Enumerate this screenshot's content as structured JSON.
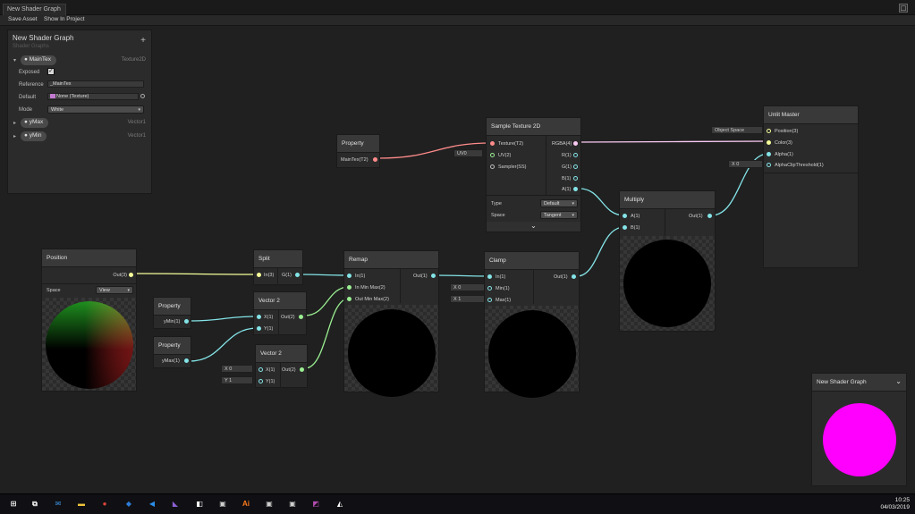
{
  "window": {
    "tab_title": "New Shader Graph"
  },
  "toolbar": {
    "save_asset": "Save Asset",
    "show_in_project": "Show In Project"
  },
  "blackboard": {
    "title": "New Shader Graph",
    "subtitle": "Shader Graphs",
    "add": "+",
    "main_tex": {
      "name": "MainTex",
      "type": "Texture2D",
      "exposed_label": "Exposed",
      "exposed_checked": "✓",
      "reference_label": "Reference",
      "reference_value": "_MainTex",
      "default_label": "Default",
      "default_value": "None (Texture)",
      "mode_label": "Mode",
      "mode_value": "White"
    },
    "ymax": {
      "name": "yMax",
      "type": "Vector1"
    },
    "ymin": {
      "name": "yMin",
      "type": "Vector1"
    }
  },
  "nodes": {
    "position": {
      "title": "Position",
      "out": "Out(3)",
      "space_label": "Space",
      "space_value": "View"
    },
    "split": {
      "title": "Split",
      "in": "In(3)",
      "out_g": "G(1)"
    },
    "property_ymin": {
      "title": "Property",
      "out": "yMin(1)"
    },
    "property_ymax": {
      "title": "Property",
      "out": "yMax(1)"
    },
    "vector2_a": {
      "title": "Vector 2",
      "x": "X(1)",
      "y": "Y(1)",
      "out": "Out(2)"
    },
    "vector2_b": {
      "title": "Vector 2",
      "x": "X(1)",
      "y": "Y(1)",
      "out": "Out(2)",
      "x_field": "X 0",
      "y_field": "Y 1"
    },
    "remap": {
      "title": "Remap",
      "in": "In(1)",
      "in_minmax": "In Min Max(2)",
      "out_minmax": "Out Min Max(2)",
      "out": "Out(1)"
    },
    "clamp": {
      "title": "Clamp",
      "in": "In(1)",
      "min": "Min(1)",
      "max": "Max(1)",
      "out": "Out(1)",
      "min_field": "X 0",
      "max_field": "X 1"
    },
    "property_maintex": {
      "title": "Property",
      "out": "MainTex(T2)"
    },
    "sample_texture": {
      "title": "Sample Texture 2D",
      "texture": "Texture(T2)",
      "uv": "UV(2)",
      "sampler": "Sampler(SS)",
      "rgba": "RGBA(4)",
      "r": "R(1)",
      "g": "G(1)",
      "b": "B(1)",
      "a": "A(1)",
      "uv_field": "UV0",
      "type_label": "Type",
      "type_value": "Default",
      "space_label": "Space",
      "space_value": "Tangent",
      "expand": "⌄"
    },
    "multiply": {
      "title": "Multiply",
      "a": "A(1)",
      "b": "B(1)",
      "out": "Out(1)"
    },
    "unlit_master": {
      "title": "Unlit Master",
      "position": "Position(3)",
      "color": "Color(3)",
      "alpha": "Alpha(1)",
      "clip": "AlphaClipThreshold(1)",
      "position_field": "Object Space",
      "clip_field": "X 0"
    }
  },
  "main_preview": {
    "title": "New Shader Graph",
    "chevron": "⌄",
    "color": "#ff00ff"
  },
  "taskbar": {
    "time": "10:25",
    "date": "04/03/2019",
    "icons": [
      {
        "name": "windows-start-icon",
        "glyph": "⊞",
        "color": "#ffffff"
      },
      {
        "name": "task-view-icon",
        "glyph": "⧉",
        "color": "#ffffff"
      },
      {
        "name": "mail-icon",
        "glyph": "✉",
        "color": "#3b8fdc"
      },
      {
        "name": "file-explorer-icon",
        "glyph": "▬",
        "color": "#f0c23a"
      },
      {
        "name": "chrome-icon",
        "glyph": "●",
        "color": "#e0453a"
      },
      {
        "name": "maps-icon",
        "glyph": "◆",
        "color": "#2d7bd6"
      },
      {
        "name": "vscode-icon",
        "glyph": "◀",
        "color": "#2b8ee8"
      },
      {
        "name": "visual-studio-icon",
        "glyph": "◣",
        "color": "#8c5fd3"
      },
      {
        "name": "app-icon",
        "glyph": "◧",
        "color": "#ffffff"
      },
      {
        "name": "game-icon",
        "glyph": "▣",
        "color": "#cfcfcf"
      },
      {
        "name": "illustrator-icon",
        "glyph": "Ai",
        "color": "#ff7b1c"
      },
      {
        "name": "game-icon-2",
        "glyph": "▣",
        "color": "#cfcfcf"
      },
      {
        "name": "game-icon-3",
        "glyph": "▣",
        "color": "#cfcfcf"
      },
      {
        "name": "app-icon-2",
        "glyph": "◩",
        "color": "#b44cb0"
      },
      {
        "name": "unity-icon",
        "glyph": "◭",
        "color": "#ffffff"
      }
    ]
  },
  "colors": {
    "vector3_port": "#f6ff9a",
    "vector1_port": "#84e4e7",
    "vector2_port": "#9aef92",
    "texture_port": "#ff8b8b",
    "vector4_port": "#fbcbf4"
  }
}
